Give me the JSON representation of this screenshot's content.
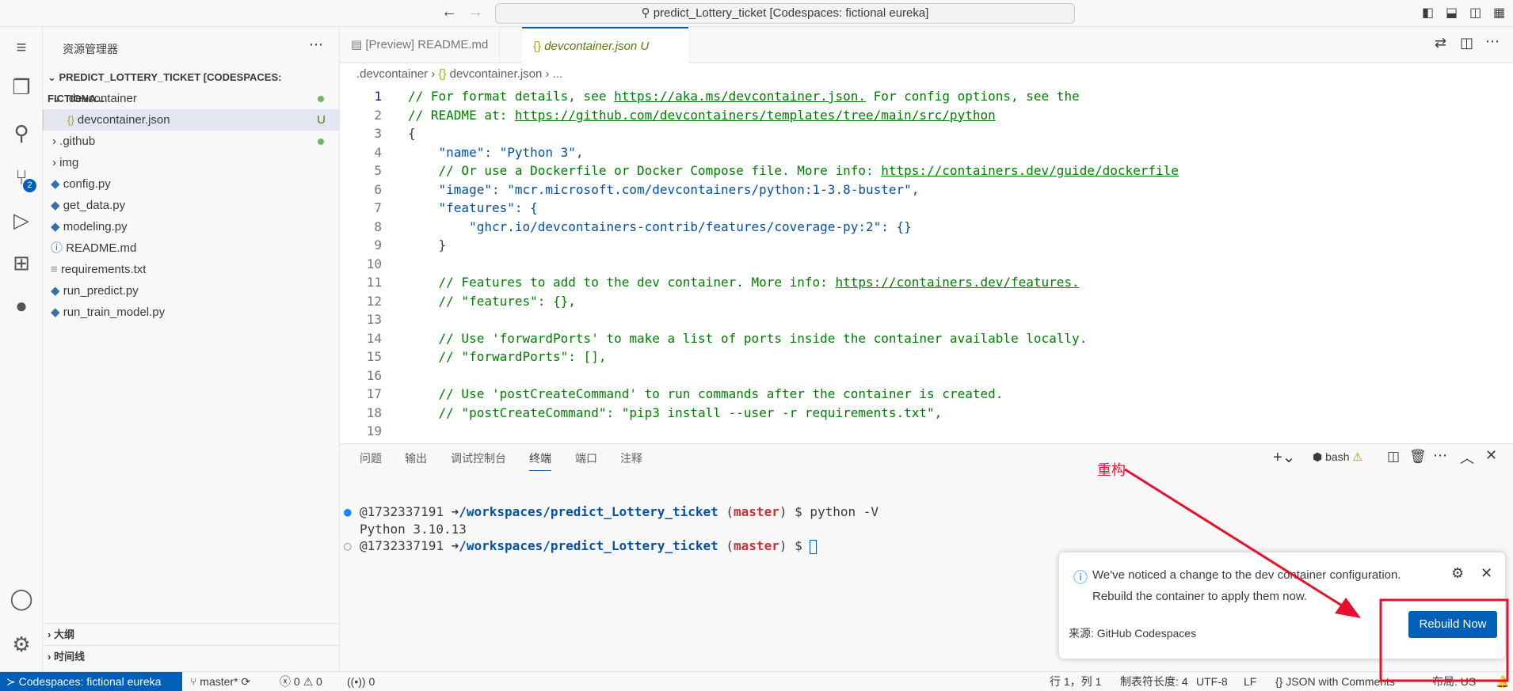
{
  "titlebar": {
    "search": "predict_Lottery_ticket [Codespaces: fictional eureka]"
  },
  "sidebar": {
    "title": "资源管理器",
    "root": "PREDICT_LOTTERY_TICKET [CODESPACES: FICTIONA...",
    "items": [
      {
        "label": ".devcontainer",
        "type": "folder-open"
      },
      {
        "label": "devcontainer.json",
        "type": "json",
        "badge": "U"
      },
      {
        "label": ".github",
        "type": "folder"
      },
      {
        "label": "img",
        "type": "folder"
      },
      {
        "label": "config.py",
        "type": "python"
      },
      {
        "label": "get_data.py",
        "type": "python"
      },
      {
        "label": "modeling.py",
        "type": "python"
      },
      {
        "label": "README.md",
        "type": "info"
      },
      {
        "label": "requirements.txt",
        "type": "text"
      },
      {
        "label": "run_predict.py",
        "type": "python"
      },
      {
        "label": "run_train_model.py",
        "type": "python"
      }
    ],
    "outline": "大纲",
    "timeline": "时间线",
    "scm_badge": "2"
  },
  "tabs": [
    {
      "label": "[Preview] README.md"
    },
    {
      "label": "devcontainer.json",
      "badge": "U",
      "active": true
    }
  ],
  "breadcrumb": [
    ".devcontainer",
    "devcontainer.json",
    "..."
  ],
  "code": [
    "// For format details, see https://aka.ms/devcontainer.json. For config options, see the",
    "// README at: https://github.com/devcontainers/templates/tree/main/src/python",
    "{",
    "    \"name\": \"Python 3\",",
    "    // Or use a Dockerfile or Docker Compose file. More info: https://containers.dev/guide/dockerfile",
    "    \"image\": \"mcr.microsoft.com/devcontainers/python:1-3.8-buster\",",
    "    \"features\": {",
    "        \"ghcr.io/devcontainers-contrib/features/coverage-py:2\": {}",
    "    }",
    "",
    "    // Features to add to the dev container. More info: https://containers.dev/features.",
    "    // \"features\": {},",
    "",
    "    // Use 'forwardPorts' to make a list of ports inside the container available locally.",
    "    // \"forwardPorts\": [],",
    "",
    "    // Use 'postCreateCommand' to run commands after the container is created.",
    "    // \"postCreateCommand\": \"pip3 install --user -r requirements.txt\",",
    ""
  ],
  "panel": {
    "tabs": [
      "问题",
      "输出",
      "调试控制台",
      "终端",
      "端口",
      "注释"
    ],
    "active": "终端",
    "shell": "bash",
    "terminal": [
      {
        "user": "@1732337191",
        "path": "/workspaces/predict_Lottery_ticket",
        "branch": "master",
        "cmd": "python -V"
      },
      {
        "output": "Python 3.10.13"
      },
      {
        "user": "@1732337191",
        "path": "/workspaces/predict_Lottery_ticket",
        "branch": "master",
        "cmd": ""
      }
    ]
  },
  "notification": {
    "line1": "We've noticed a change to the dev container configuration.",
    "line2": "Rebuild the container to apply them now.",
    "source": "来源: GitHub Codespaces",
    "button": "Rebuild Now"
  },
  "annotation": {
    "label": "重构",
    "color": "#e8112d"
  },
  "status": {
    "remote": "Codespaces: fictional eureka",
    "branch": "master*",
    "errors": "0",
    "warnings": "0",
    "ports": "0",
    "position": "行 1，列 1",
    "indent": "制表符长度: 4",
    "encoding": "UTF-8",
    "eol": "LF",
    "language": "JSON with Comments",
    "layout": "布局: US"
  }
}
